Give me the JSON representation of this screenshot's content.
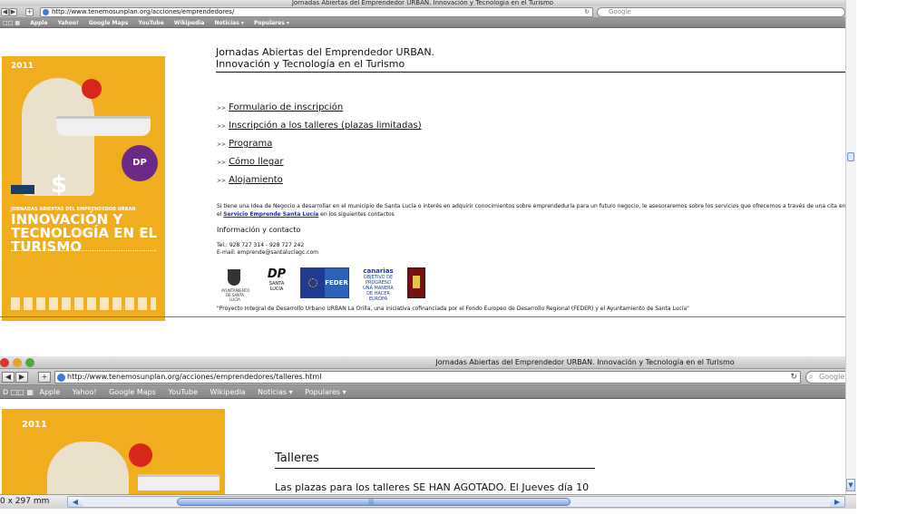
{
  "top_window": {
    "title": "Jornadas Abiertas del Emprendedor URBAN. Innovación y Tecnología en el Turismo",
    "url": "http://www.tenemosunplan.org/acciones/emprendedores/",
    "search_placeholder": "Google",
    "bookmarks": [
      "Apple",
      "Yahoo!",
      "Google Maps",
      "YouTube",
      "Wikipedia",
      "Noticias ▾",
      "Populares ▾"
    ],
    "poster": {
      "year": "2011",
      "badge": "DP",
      "headline_small": "JORNADAS ABIERTAS DEL EMPRENDEDOR URBAN",
      "headline": "INNOVACIÓN Y TECNOLOGÍA EN EL TURISMO"
    },
    "page_title_line1": "Jornadas Abiertas del Emprendedor URBAN.",
    "page_title_line2": "Innovación y Tecnología en el Turismo",
    "links": [
      {
        "arrow": ">>",
        "label": "Formulario de inscripción"
      },
      {
        "arrow": ">>",
        "label": "Inscripción a los talleres (plazas limitadas)"
      },
      {
        "arrow": ">>",
        "label": "Programa"
      },
      {
        "arrow": ">>",
        "label": "Cómo llegar"
      },
      {
        "arrow": ">>",
        "label": "Alojamiento"
      }
    ],
    "description_1": "Si tiene una Idea de Negocio a desarrollar en el municipio de Santa Lucía o interés en adquirir conocimientos sobre emprendeduría para un futuro negocio, le asesoraremos sobre los servicios que ofrecemos a través de una cita en",
    "description_2_prefix": "el ",
    "service_link": "Servicio Emprende Santa Lucía",
    "description_2_suffix": " en los siguientes contactos",
    "info_heading": "Información y contacto",
    "phone": "Tel.: 928 727 314 - 928 727 242",
    "email": "E-mail: emprende@santaluciagc.com",
    "sponsors": {
      "ayto_caption": "AYUNTAMIENTO DE SANTA LUCÍA",
      "dp_mark": "DP",
      "dp_caption": "SANTA LUCÍA",
      "feder": "FEDER",
      "canarias_title": "canarias",
      "canarias_sub": "OBJETIVO DE PROGRESO UNA MANERA DE HACER EUROPA"
    },
    "footnote": "\"Proyecto Integral de Desarrollo Urbano URBAN La Orilla, una iniciativa cofinanciada por el Fondo Europeo de Desarrollo Regional (FEDER) y el Ayuntamiento de Santa Lucía\""
  },
  "bottom_window": {
    "title": "Jornadas Abiertas del Emprendedor URBAN. Innovación y Tecnología en el Turismo",
    "url": "http://www.tenemosunplan.org/acciones/emprendedores/talleres.html",
    "search_placeholder": "Google",
    "bookmarks": [
      "Apple",
      "Yahoo!",
      "Google Maps",
      "YouTube",
      "Wikipedia",
      "Noticias ▾",
      "Populares ▾"
    ],
    "poster_year": "2011",
    "heading": "Talleres",
    "body_line": "Las plazas para los talleres SE HAN AGOTADO. El Jueves día 10"
  },
  "status": {
    "page_size": "0 x 297 mm"
  }
}
